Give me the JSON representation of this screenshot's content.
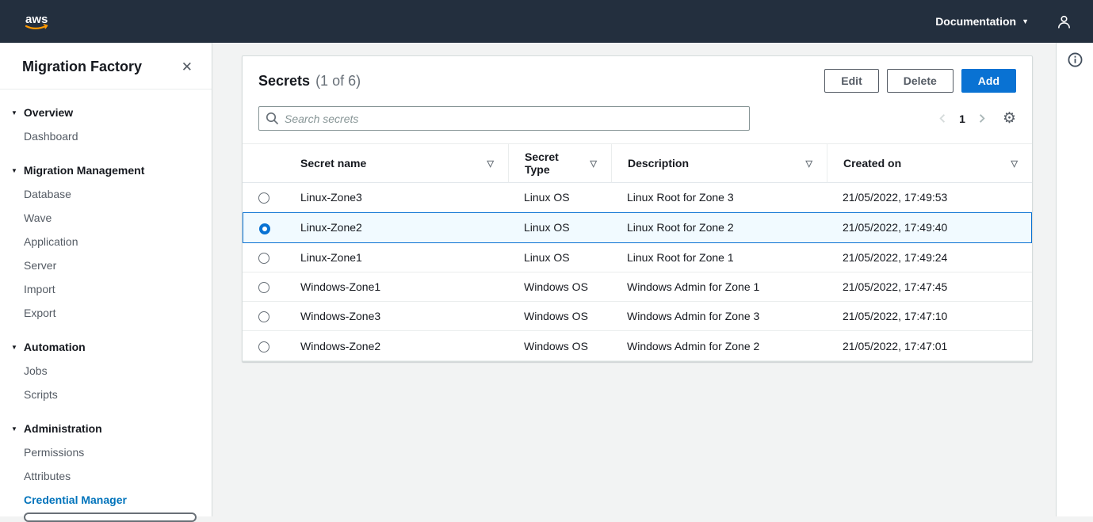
{
  "topbar": {
    "logo": "aws",
    "documentation_label": "Documentation"
  },
  "sidebar": {
    "title": "Migration Factory",
    "sections": [
      {
        "label": "Overview",
        "items": [
          {
            "label": "Dashboard"
          }
        ]
      },
      {
        "label": "Migration Management",
        "items": [
          {
            "label": "Database"
          },
          {
            "label": "Wave"
          },
          {
            "label": "Application"
          },
          {
            "label": "Server"
          },
          {
            "label": "Import"
          },
          {
            "label": "Export"
          }
        ]
      },
      {
        "label": "Automation",
        "items": [
          {
            "label": "Jobs"
          },
          {
            "label": "Scripts"
          }
        ]
      },
      {
        "label": "Administration",
        "items": [
          {
            "label": "Permissions"
          },
          {
            "label": "Attributes"
          },
          {
            "label": "Credential Manager",
            "active": true
          }
        ]
      }
    ]
  },
  "main": {
    "panel_title": "Secrets",
    "panel_count": "(1 of 6)",
    "buttons": {
      "edit": "Edit",
      "delete": "Delete",
      "add": "Add"
    },
    "search": {
      "placeholder": "Search secrets"
    },
    "pagination": {
      "current_page": "1"
    },
    "table": {
      "columns": [
        "Secret name",
        "Secret Type",
        "Description",
        "Created on"
      ],
      "rows": [
        {
          "secret_name": "Linux-Zone3",
          "secret_type": "Linux OS",
          "description": "Linux Root for Zone 3",
          "created_on": "21/05/2022, 17:49:53",
          "selected": false
        },
        {
          "secret_name": "Linux-Zone2",
          "secret_type": "Linux OS",
          "description": "Linux Root for Zone 2",
          "created_on": "21/05/2022, 17:49:40",
          "selected": true
        },
        {
          "secret_name": "Linux-Zone1",
          "secret_type": "Linux OS",
          "description": "Linux Root for Zone 1",
          "created_on": "21/05/2022, 17:49:24",
          "selected": false
        },
        {
          "secret_name": "Windows-Zone1",
          "secret_type": "Windows OS",
          "description": "Windows Admin for Zone 1",
          "created_on": "21/05/2022, 17:47:45",
          "selected": false
        },
        {
          "secret_name": "Windows-Zone3",
          "secret_type": "Windows OS",
          "description": "Windows Admin for Zone 3",
          "created_on": "21/05/2022, 17:47:10",
          "selected": false
        },
        {
          "secret_name": "Windows-Zone2",
          "secret_type": "Windows OS",
          "description": "Windows Admin for Zone 2",
          "created_on": "21/05/2022, 17:47:01",
          "selected": false
        }
      ]
    }
  },
  "colors": {
    "topbar_bg": "#232f3e",
    "accent": "#0972d3",
    "link": "#0073bb",
    "selected_row_bg": "#f1faff",
    "logo_orange": "#ff9900"
  }
}
